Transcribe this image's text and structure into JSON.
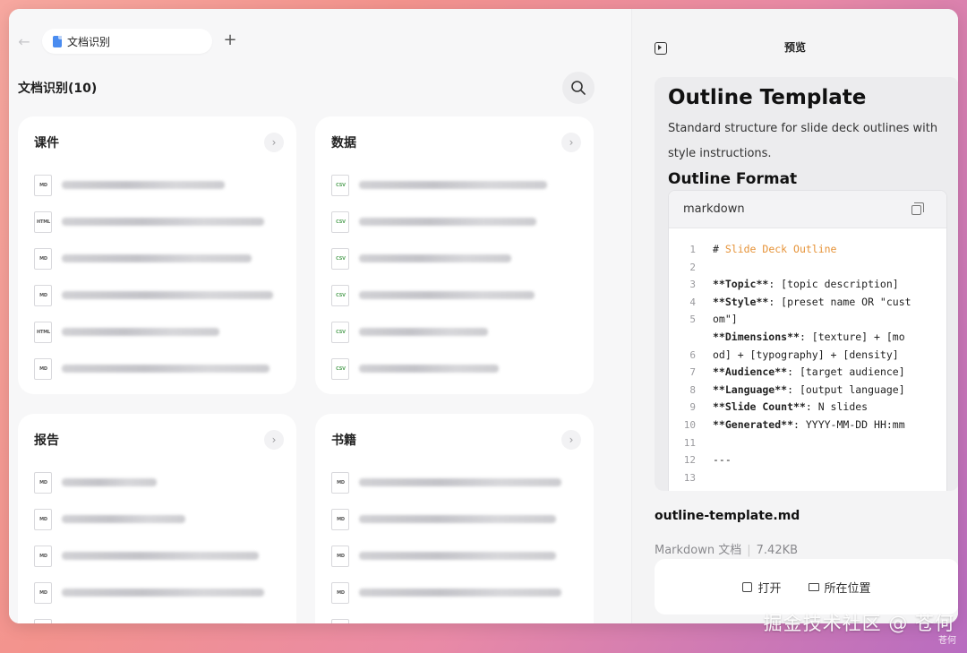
{
  "tabbar": {
    "tab_label": "文档识别",
    "add_label": "+",
    "back_label": "←"
  },
  "left": {
    "title": "文档识别(10)"
  },
  "cards": [
    {
      "title": "课件",
      "files": [
        {
          "type": "MD"
        },
        {
          "type": "HTML"
        },
        {
          "type": "MD"
        },
        {
          "type": "MD"
        },
        {
          "type": "HTML"
        },
        {
          "type": "MD"
        }
      ]
    },
    {
      "title": "数据",
      "files": [
        {
          "type": "CSV"
        },
        {
          "type": "CSV"
        },
        {
          "type": "CSV"
        },
        {
          "type": "CSV"
        },
        {
          "type": "CSV"
        },
        {
          "type": "CSV"
        }
      ]
    },
    {
      "title": "报告",
      "files": [
        {
          "type": "MD"
        },
        {
          "type": "MD"
        },
        {
          "type": "MD"
        },
        {
          "type": "MD"
        },
        {
          "type": "MD"
        }
      ]
    },
    {
      "title": "书籍",
      "files": [
        {
          "type": "MD"
        },
        {
          "type": "MD"
        },
        {
          "type": "MD"
        },
        {
          "type": "MD"
        },
        {
          "type": "MD"
        }
      ]
    }
  ],
  "card_more_label": "›",
  "right": {
    "header_title": "预览",
    "preview": {
      "h1": "Outline Template",
      "desc": "Standard structure for slide deck outlines with style instructions.",
      "h2": "Outline Format",
      "code_lang": "markdown",
      "lines": [
        {
          "n": "1",
          "parts": [
            {
              "t": "# ",
              "s": ""
            },
            {
              "t": "Slide Deck Outline",
              "s": "orange"
            }
          ]
        },
        {
          "n": "2",
          "parts": []
        },
        {
          "n": "3",
          "parts": [
            {
              "t": "**Topic**",
              "s": "b"
            },
            {
              "t": ": [topic description]",
              "s": ""
            }
          ]
        },
        {
          "n": "4",
          "parts": [
            {
              "t": "**Style**",
              "s": "b"
            },
            {
              "t": ": [preset name OR \"cust",
              "s": ""
            }
          ]
        },
        {
          "n": "5",
          "parts": [
            {
              "t": "om\"]",
              "s": ""
            }
          ]
        },
        {
          "n": "",
          "parts": [
            {
              "t": "**Dimensions**",
              "s": "b"
            },
            {
              "t": ": [texture] + [mo",
              "s": ""
            }
          ]
        },
        {
          "n": "6",
          "parts": [
            {
              "t": "od] + [typography] + [density]",
              "s": ""
            }
          ]
        },
        {
          "n": "7",
          "parts": [
            {
              "t": "**Audience**",
              "s": "b"
            },
            {
              "t": ": [target audience]",
              "s": ""
            }
          ]
        },
        {
          "n": "8",
          "parts": [
            {
              "t": "**Language**",
              "s": "b"
            },
            {
              "t": ": [output language]",
              "s": ""
            }
          ]
        },
        {
          "n": "9",
          "parts": [
            {
              "t": "**Slide Count**",
              "s": "b"
            },
            {
              "t": ": N slides",
              "s": ""
            }
          ]
        },
        {
          "n": "10",
          "parts": [
            {
              "t": "**Generated**",
              "s": "b"
            },
            {
              "t": ": YYYY-MM-DD HH:mm",
              "s": ""
            }
          ]
        },
        {
          "n": "11",
          "parts": []
        },
        {
          "n": "12",
          "parts": [
            {
              "t": "---",
              "s": ""
            }
          ]
        },
        {
          "n": "13",
          "parts": []
        }
      ]
    },
    "file_name": "outline-template.md",
    "file_type": "Markdown 文档",
    "file_size": "7.42KB",
    "open_label": "打开",
    "location_label": "所在位置"
  },
  "watermark": "掘金技术社区 @ 苍何",
  "watermark_small": "苍何",
  "colors": {
    "accent": "#4a8cf0",
    "csv": "#5aa55e",
    "heading_orange": "#e69338"
  }
}
